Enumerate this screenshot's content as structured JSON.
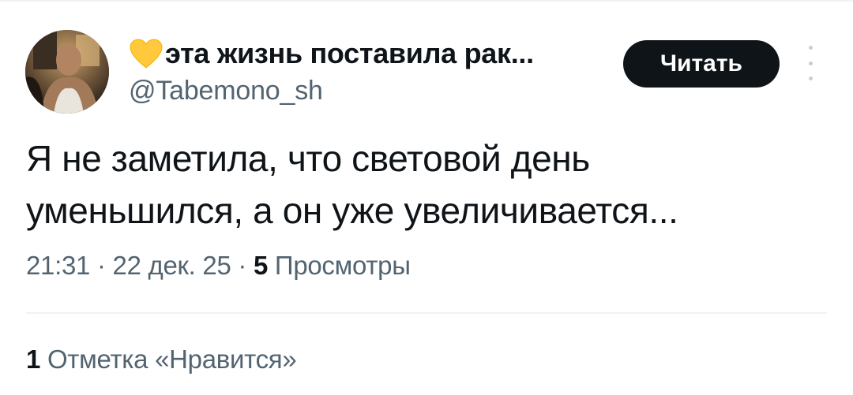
{
  "author": {
    "display_name": "эта жизнь поставила рак...",
    "handle": "@Tabemono_sh",
    "name_emoji": "yellow-heart-icon"
  },
  "actions": {
    "read_label": "Читать",
    "more_icon": "more-vertical-icon"
  },
  "tweet": {
    "text_line_1": "Я не заметила, что световой день",
    "text_line_2": "уменьшился, а он уже увеличивается..."
  },
  "meta": {
    "time": "21:31",
    "separator": "·",
    "date": "22 дек. 25",
    "views_count": "5",
    "views_label": "Просмотры"
  },
  "engagement": {
    "likes_count": "1",
    "likes_label": "Отметка «Нравится»"
  },
  "colors": {
    "text_primary": "#0f1419",
    "text_secondary": "#536471",
    "button_bg": "#0f1419",
    "heart": "#ffc83d",
    "divider": "#eff3f4"
  }
}
